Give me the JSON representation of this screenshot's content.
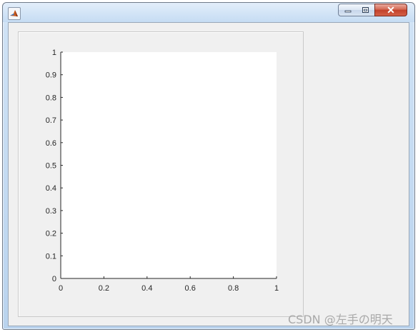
{
  "window": {
    "title": "",
    "icon": "matlab-icon",
    "controls": {
      "minimize_icon": "minimize-icon",
      "maximize_icon": "restore-icon",
      "close_label": "✕"
    }
  },
  "figure": {
    "background": "#f0f0f0",
    "axes_background": "#ffffff",
    "axis_color": "#262626"
  },
  "chart_data": {
    "type": "scatter",
    "title": "",
    "xlabel": "",
    "ylabel": "",
    "xlim": [
      0,
      1
    ],
    "ylim": [
      0,
      1
    ],
    "x_ticks": [
      "0",
      "0.2",
      "0.4",
      "0.6",
      "0.8",
      "1"
    ],
    "y_ticks": [
      "0",
      "0.1",
      "0.2",
      "0.3",
      "0.4",
      "0.5",
      "0.6",
      "0.7",
      "0.8",
      "0.9",
      "1"
    ],
    "grid": false,
    "series": []
  },
  "watermark": {
    "text": "CSDN @左手の明天"
  }
}
